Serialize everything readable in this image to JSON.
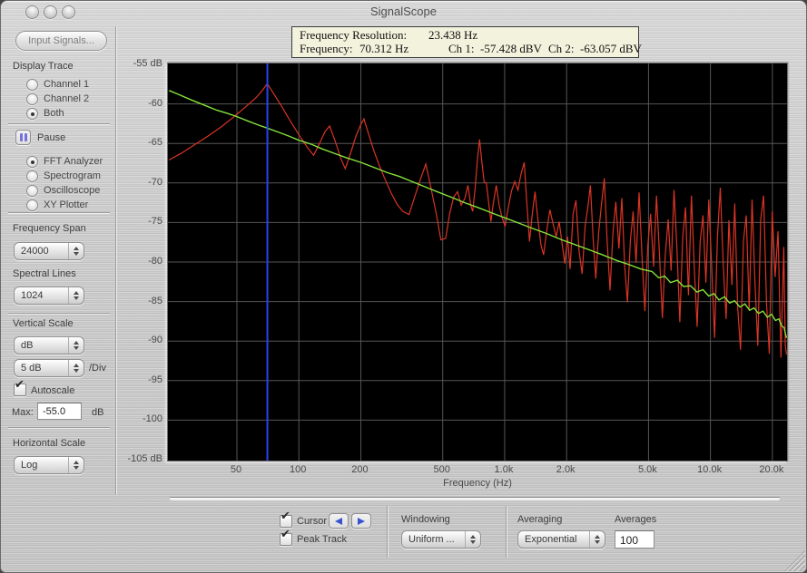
{
  "window": {
    "title": "SignalScope"
  },
  "icons": {
    "pause": "two-vertical-bars",
    "cursor_prev": "left-filled-triangle",
    "cursor_next": "right-filled-triangle",
    "popup_stepper": "up-down-arrows",
    "checkbox_tick": "checkmark",
    "resize": "diagonal-grip-lines"
  },
  "colors": {
    "trace_ch1": "#d93425",
    "trace_ch2": "#84e23a",
    "cursor": "#2743ee",
    "grid": "#565656",
    "plot_bg": "#000000",
    "readout_bg": "#f2f2dd"
  },
  "sidebar": {
    "input_signals_button": "Input Signals...",
    "display_trace": {
      "label": "Display Trace",
      "options": [
        "Channel 1",
        "Channel 2",
        "Both"
      ],
      "selected": "Both"
    },
    "pause": {
      "label": "Pause"
    },
    "mode": {
      "options": [
        "FFT Analyzer",
        "Spectrogram",
        "Oscilloscope",
        "XY Plotter"
      ],
      "selected": "FFT Analyzer"
    },
    "frequency_span": {
      "label": "Frequency Span",
      "value": "24000"
    },
    "spectral_lines": {
      "label": "Spectral Lines",
      "value": "1024"
    },
    "vertical_scale": {
      "label": "Vertical Scale",
      "unit_value": "dB",
      "div_value": "5 dB",
      "div_suffix": "/Div"
    },
    "autoscale": {
      "label": "Autoscale",
      "checked": true
    },
    "max": {
      "label": "Max:",
      "value": "-55.0",
      "unit": "dB"
    },
    "horizontal_scale": {
      "label": "Horizontal Scale",
      "value": "Log"
    }
  },
  "readout": {
    "row1_label": "Frequency Resolution:",
    "row1_value": "23.438 Hz",
    "freq_label": "Frequency:",
    "freq_value": "70.312 Hz",
    "ch1_label": "Ch 1:",
    "ch1_value": "-57.428 dBV",
    "ch2_label": "Ch 2:",
    "ch2_value": "-63.057 dBV"
  },
  "bottom": {
    "cursor": {
      "label": "Cursor",
      "checked": true
    },
    "peak_track": {
      "label": "Peak Track",
      "checked": true
    },
    "windowing": {
      "label": "Windowing",
      "value": "Uniform ..."
    },
    "averaging": {
      "label": "Averaging",
      "value": "Exponential"
    },
    "averages": {
      "label": "Averages",
      "value": "100"
    }
  },
  "chart_data": {
    "type": "line",
    "xlabel": "Frequency (Hz)",
    "x_scale": "log",
    "x_range_hz": [
      23.4,
      23600
    ],
    "y_range_db": [
      -105,
      -55
    ],
    "cursor_hz": 70.312,
    "x_ticks": [
      {
        "hz": 50,
        "label": "50"
      },
      {
        "hz": 100,
        "label": "100"
      },
      {
        "hz": 200,
        "label": "200"
      },
      {
        "hz": 500,
        "label": "500"
      },
      {
        "hz": 1000,
        "label": "1.0k"
      },
      {
        "hz": 2000,
        "label": "2.0k"
      },
      {
        "hz": 5000,
        "label": "5.0k"
      },
      {
        "hz": 10000,
        "label": "10.0k"
      },
      {
        "hz": 20000,
        "label": "20.0k"
      }
    ],
    "y_ticks": [
      {
        "db": -55,
        "label": "-55 dB"
      },
      {
        "db": -60,
        "label": "-60"
      },
      {
        "db": -65,
        "label": "-65"
      },
      {
        "db": -70,
        "label": "-70"
      },
      {
        "db": -75,
        "label": "-75"
      },
      {
        "db": -80,
        "label": "-80"
      },
      {
        "db": -85,
        "label": "-85"
      },
      {
        "db": -90,
        "label": "-90"
      },
      {
        "db": -95,
        "label": "-95"
      },
      {
        "db": -100,
        "label": "-100"
      },
      {
        "db": -105,
        "label": "-105 dB"
      }
    ],
    "series": [
      {
        "name": "Ch 1",
        "color": "#d93425",
        "points": [
          [
            23.4,
            -67.1
          ],
          [
            27,
            -66.2
          ],
          [
            31,
            -65.2
          ],
          [
            36,
            -64.1
          ],
          [
            42,
            -62.9
          ],
          [
            48,
            -61.7
          ],
          [
            55,
            -60.4
          ],
          [
            62,
            -59.2
          ],
          [
            66,
            -58.4
          ],
          [
            70.3,
            -57.43
          ],
          [
            75,
            -58.6
          ],
          [
            82,
            -60.2
          ],
          [
            90,
            -62.0
          ],
          [
            100,
            -63.9
          ],
          [
            110,
            -65.5
          ],
          [
            118,
            -66.5
          ],
          [
            126,
            -65.0
          ],
          [
            134,
            -63.5
          ],
          [
            141,
            -62.8
          ],
          [
            150,
            -64.7
          ],
          [
            160,
            -66.9
          ],
          [
            168,
            -68.2
          ],
          [
            178,
            -66.3
          ],
          [
            190,
            -64.0
          ],
          [
            200,
            -62.6
          ],
          [
            207,
            -61.9
          ],
          [
            218,
            -63.8
          ],
          [
            232,
            -66.0
          ],
          [
            246,
            -67.8
          ],
          [
            260,
            -69.3
          ],
          [
            280,
            -71.2
          ],
          [
            300,
            -72.7
          ],
          [
            320,
            -73.6
          ],
          [
            343,
            -74.0
          ],
          [
            365,
            -71.8
          ],
          [
            390,
            -69.5
          ],
          [
            414,
            -67.6
          ],
          [
            440,
            -70.8
          ],
          [
            465,
            -73.9
          ],
          [
            490,
            -77.2
          ],
          [
            517,
            -77.0
          ],
          [
            540,
            -73.9
          ],
          [
            565,
            -71.8
          ],
          [
            590,
            -71.1
          ],
          [
            615,
            -72.8
          ],
          [
            640,
            -72.0
          ],
          [
            663,
            -70.3
          ],
          [
            685,
            -72.9
          ],
          [
            700,
            -73.6
          ],
          [
            720,
            -70.4
          ],
          [
            738,
            -66.9
          ],
          [
            755,
            -64.5
          ],
          [
            775,
            -67.3
          ],
          [
            795,
            -69.9
          ],
          [
            815,
            -70.0
          ],
          [
            835,
            -72.4
          ],
          [
            857,
            -74.9
          ],
          [
            880,
            -72.6
          ],
          [
            910,
            -70.3
          ],
          [
            940,
            -72.8
          ],
          [
            970,
            -74.3
          ],
          [
            1005,
            -75.5
          ],
          [
            1040,
            -73.2
          ],
          [
            1080,
            -71.0
          ],
          [
            1120,
            -69.8
          ],
          [
            1160,
            -70.9
          ],
          [
            1200,
            -68.9
          ],
          [
            1245,
            -67.4
          ],
          [
            1280,
            -72.3
          ],
          [
            1320,
            -77.4
          ],
          [
            1360,
            -74.1
          ],
          [
            1405,
            -71.1
          ],
          [
            1450,
            -74.6
          ],
          [
            1500,
            -77.8
          ],
          [
            1545,
            -79.1
          ],
          [
            1600,
            -76.1
          ],
          [
            1660,
            -73.4
          ],
          [
            1720,
            -75.2
          ],
          [
            1780,
            -76.8
          ],
          [
            1840,
            -74.9
          ],
          [
            1900,
            -77.6
          ],
          [
            1960,
            -80.2
          ],
          [
            2020,
            -76.8
          ],
          [
            2080,
            -80.9
          ],
          [
            2150,
            -73.9
          ],
          [
            2220,
            -72.2
          ],
          [
            2300,
            -78.6
          ],
          [
            2380,
            -81.5
          ],
          [
            2460,
            -75.4
          ],
          [
            2540,
            -73.0
          ],
          [
            2610,
            -70.3
          ],
          [
            2690,
            -77.0
          ],
          [
            2770,
            -82.1
          ],
          [
            2860,
            -76.4
          ],
          [
            2950,
            -72.8
          ],
          [
            3050,
            -69.4
          ],
          [
            3150,
            -77.5
          ],
          [
            3250,
            -83.6
          ],
          [
            3360,
            -76.2
          ],
          [
            3470,
            -72.4
          ],
          [
            3590,
            -78.3
          ],
          [
            3710,
            -71.9
          ],
          [
            3830,
            -80.6
          ],
          [
            3950,
            -85.1
          ],
          [
            4080,
            -77.3
          ],
          [
            4210,
            -73.6
          ],
          [
            4350,
            -80.1
          ],
          [
            4500,
            -71.2
          ],
          [
            4650,
            -79.4
          ],
          [
            4800,
            -86.2
          ],
          [
            4960,
            -78.0
          ],
          [
            5120,
            -73.9
          ],
          [
            5290,
            -80.6
          ],
          [
            5470,
            -71.6
          ],
          [
            5650,
            -78.8
          ],
          [
            5840,
            -87.1
          ],
          [
            6030,
            -79.2
          ],
          [
            6230,
            -74.6
          ],
          [
            6440,
            -81.1
          ],
          [
            6650,
            -70.9
          ],
          [
            6870,
            -78.2
          ],
          [
            7100,
            -87.6
          ],
          [
            7330,
            -76.8
          ],
          [
            7570,
            -73.1
          ],
          [
            7820,
            -84.2
          ],
          [
            8080,
            -71.6
          ],
          [
            8350,
            -80.9
          ],
          [
            8620,
            -88.2
          ],
          [
            8910,
            -77.4
          ],
          [
            9200,
            -74.1
          ],
          [
            9500,
            -82.6
          ],
          [
            9810,
            -72.1
          ],
          [
            10130,
            -80.3
          ],
          [
            10470,
            -89.6
          ],
          [
            10810,
            -76.9
          ],
          [
            11170,
            -70.6
          ],
          [
            11530,
            -80.2
          ],
          [
            11910,
            -87.2
          ],
          [
            12300,
            -74.7
          ],
          [
            12710,
            -82.9
          ],
          [
            13120,
            -72.6
          ],
          [
            13550,
            -85.7
          ],
          [
            14000,
            -91.1
          ],
          [
            14460,
            -77.3
          ],
          [
            14930,
            -74.1
          ],
          [
            15420,
            -86.1
          ],
          [
            15930,
            -72.1
          ],
          [
            16450,
            -82.4
          ],
          [
            16990,
            -90.6
          ],
          [
            17550,
            -74.6
          ],
          [
            18120,
            -71.6
          ],
          [
            18720,
            -85.2
          ],
          [
            19330,
            -91.6
          ],
          [
            19970,
            -73.6
          ],
          [
            20620,
            -81.9
          ],
          [
            21300,
            -76.1
          ],
          [
            22000,
            -92.1
          ],
          [
            22700,
            -78.1
          ],
          [
            23100,
            -90.6
          ],
          [
            23438,
            -91.7
          ]
        ]
      },
      {
        "name": "Ch 2",
        "color": "#84e23a",
        "points": [
          [
            23.4,
            -58.3
          ],
          [
            26,
            -58.8
          ],
          [
            30,
            -59.5
          ],
          [
            35,
            -60.2
          ],
          [
            40,
            -60.8
          ],
          [
            45,
            -61.2
          ],
          [
            50,
            -61.6
          ],
          [
            57,
            -62.2
          ],
          [
            64,
            -62.7
          ],
          [
            70.3,
            -63.06
          ],
          [
            80,
            -63.6
          ],
          [
            90,
            -64.1
          ],
          [
            100,
            -64.6
          ],
          [
            115,
            -65.1
          ],
          [
            130,
            -65.7
          ],
          [
            150,
            -66.3
          ],
          [
            170,
            -66.8
          ],
          [
            200,
            -67.4
          ],
          [
            230,
            -68.0
          ],
          [
            270,
            -68.7
          ],
          [
            310,
            -69.2
          ],
          [
            360,
            -69.9
          ],
          [
            420,
            -70.6
          ],
          [
            480,
            -71.2
          ],
          [
            550,
            -71.8
          ],
          [
            640,
            -72.5
          ],
          [
            740,
            -73.1
          ],
          [
            850,
            -73.7
          ],
          [
            1000,
            -74.4
          ],
          [
            1150,
            -75.0
          ],
          [
            1350,
            -75.7
          ],
          [
            1600,
            -76.4
          ],
          [
            1900,
            -77.2
          ],
          [
            2200,
            -77.8
          ],
          [
            2600,
            -78.5
          ],
          [
            3000,
            -79.1
          ],
          [
            3500,
            -79.8
          ],
          [
            4000,
            -80.3
          ],
          [
            4600,
            -80.9
          ],
          [
            5200,
            -81.2
          ],
          [
            5600,
            -82.0
          ],
          [
            6000,
            -81.8
          ],
          [
            6400,
            -82.6
          ],
          [
            6900,
            -82.3
          ],
          [
            7400,
            -83.1
          ],
          [
            8000,
            -83.0
          ],
          [
            8600,
            -83.8
          ],
          [
            9200,
            -83.5
          ],
          [
            9800,
            -84.3
          ],
          [
            10400,
            -84.0
          ],
          [
            11000,
            -84.8
          ],
          [
            11700,
            -84.4
          ],
          [
            12400,
            -85.2
          ],
          [
            13100,
            -84.9
          ],
          [
            13900,
            -85.7
          ],
          [
            14700,
            -85.3
          ],
          [
            15500,
            -86.1
          ],
          [
            16300,
            -85.8
          ],
          [
            17100,
            -86.5
          ],
          [
            18000,
            -86.2
          ],
          [
            18900,
            -87.0
          ],
          [
            19800,
            -86.6
          ],
          [
            20700,
            -87.4
          ],
          [
            21500,
            -87.2
          ],
          [
            22200,
            -88.1
          ],
          [
            22800,
            -88.3
          ],
          [
            23100,
            -89.0
          ],
          [
            23438,
            -89.6
          ]
        ]
      }
    ]
  }
}
